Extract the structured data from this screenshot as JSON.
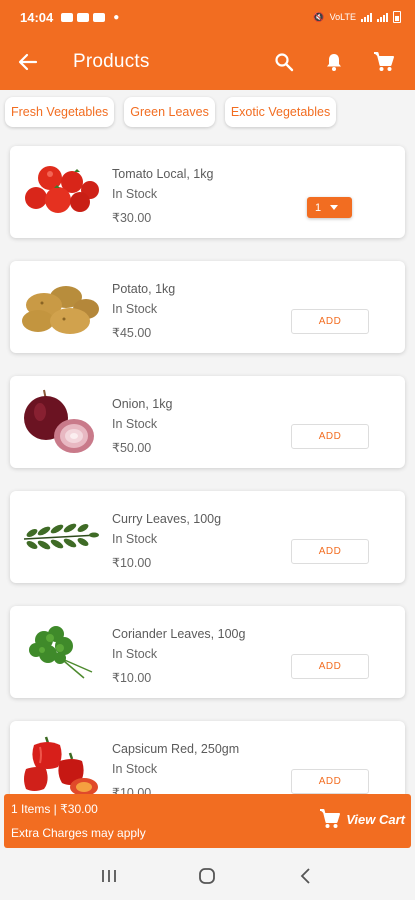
{
  "status_bar": {
    "time": "14:04",
    "carrier": "VoLTE"
  },
  "app_bar": {
    "title": "Products",
    "icons": [
      "back-arrow-icon",
      "search-icon",
      "bell-icon",
      "cart-icon"
    ]
  },
  "categories": [
    "Fresh Vegetables",
    "Green Leaves",
    "Exotic Vegetables"
  ],
  "products": [
    {
      "name": "Tomato Local, 1kg",
      "stock": "In Stock",
      "price": "₹30.00",
      "image": "tomato",
      "action": "1"
    },
    {
      "name": "Potato, 1kg",
      "stock": "In Stock",
      "price": "₹45.00",
      "image": "potato",
      "action": "ADD"
    },
    {
      "name": "Onion, 1kg",
      "stock": "In Stock",
      "price": "₹50.00",
      "image": "onion",
      "action": "ADD"
    },
    {
      "name": "Curry Leaves, 100g",
      "stock": "In Stock",
      "price": "₹10.00",
      "image": "curry-leaves",
      "action": "ADD"
    },
    {
      "name": "Coriander Leaves, 100g",
      "stock": "In Stock",
      "price": "₹10.00",
      "image": "coriander",
      "action": "ADD"
    },
    {
      "name": "Capsicum Red, 250gm",
      "stock": "In Stock",
      "price": "₹10.00",
      "image": "capsicum",
      "action": "ADD"
    }
  ],
  "cart_bar": {
    "summary": "1 Items | ₹30.00",
    "note": "Extra Charges may apply",
    "button_label": "View Cart"
  },
  "colors": {
    "primary": "#f26d21",
    "background": "#f4f4f4"
  }
}
